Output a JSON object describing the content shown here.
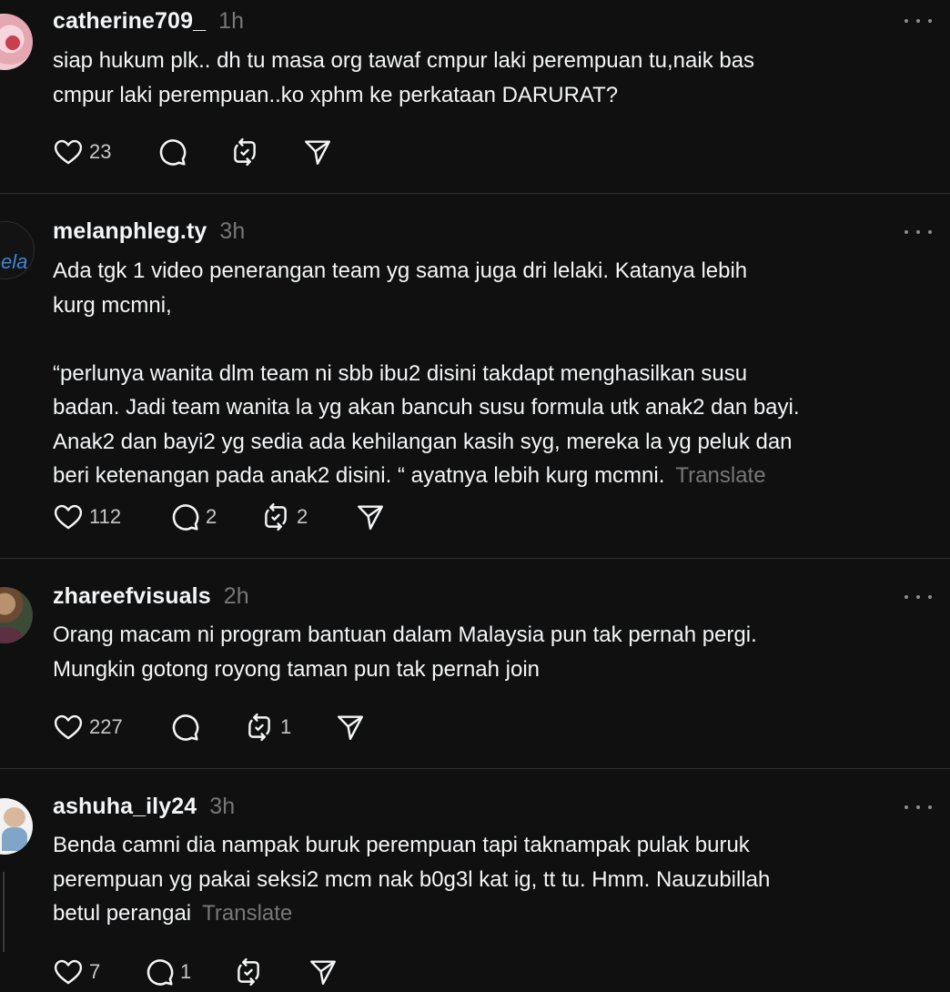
{
  "posts": [
    {
      "username": "catherine709_",
      "time": "1h",
      "text": "siap hukum plk.. dh tu masa org tawaf cmpur laki perempuan tu,naik bas\ncmpur laki perempuan..ko xphm ke perkataan DARURAT?",
      "translate": "",
      "likes": "23",
      "replies": "",
      "reposts": ""
    },
    {
      "username": "melanphleg.ty",
      "time": "3h",
      "avatar_text": "ela",
      "text": "Ada tgk 1 video penerangan team yg sama juga dri lelaki. Katanya lebih\nkurg mcmni,\n\n“perlunya wanita dlm team ni sbb ibu2 disini takdapt menghasilkan susu\nbadan. Jadi team wanita la yg akan bancuh susu formula utk anak2 dan bayi.\nAnak2 dan bayi2 yg sedia ada kehilangan kasih syg, mereka la yg peluk dan\nberi ketenangan pada anak2 disini. “ ayatnya lebih kurg mcmni.",
      "translate": "Translate",
      "likes": "112",
      "replies": "2",
      "reposts": "2"
    },
    {
      "username": "zhareefvisuals",
      "time": "2h",
      "text": "Orang macam ni program bantuan dalam Malaysia pun tak pernah pergi.\nMungkin gotong royong taman pun tak pernah join",
      "translate": "",
      "likes": "227",
      "replies": "",
      "reposts": "1"
    },
    {
      "username": "ashuha_ily24",
      "time": "3h",
      "text": "Benda camni dia nampak buruk perempuan tapi taknampak pulak buruk\nperempuan yg pakai seksi2 mcm nak b0g3l kat ig, tt tu. Hmm. Nauzubillah\nbetul perangai",
      "translate": "Translate",
      "likes": "7",
      "replies": "1",
      "reposts": ""
    }
  ],
  "icons": {
    "like": "heart-icon",
    "reply": "comment-icon",
    "repost": "repost-icon",
    "share": "send-icon",
    "more": "more-icon"
  },
  "colors": {
    "background": "#101010",
    "text": "#f3f5f7",
    "muted": "#777777",
    "divider": "#323232"
  }
}
